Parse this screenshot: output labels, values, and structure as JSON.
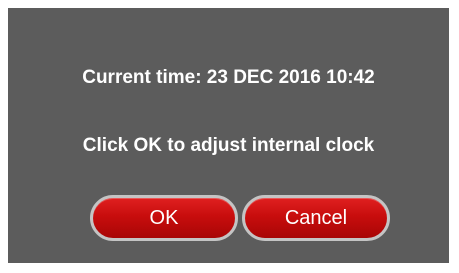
{
  "dialog": {
    "current_time_text": "Current time: 23 DEC 2016 10:42",
    "prompt_text": "Click OK to adjust internal clock",
    "ok_label": "OK",
    "cancel_label": "Cancel"
  },
  "colors": {
    "dialog_background": "#5c5c5c",
    "button_red": "#c80d0d",
    "button_border": "#c4c4c4",
    "text": "#ffffff"
  }
}
